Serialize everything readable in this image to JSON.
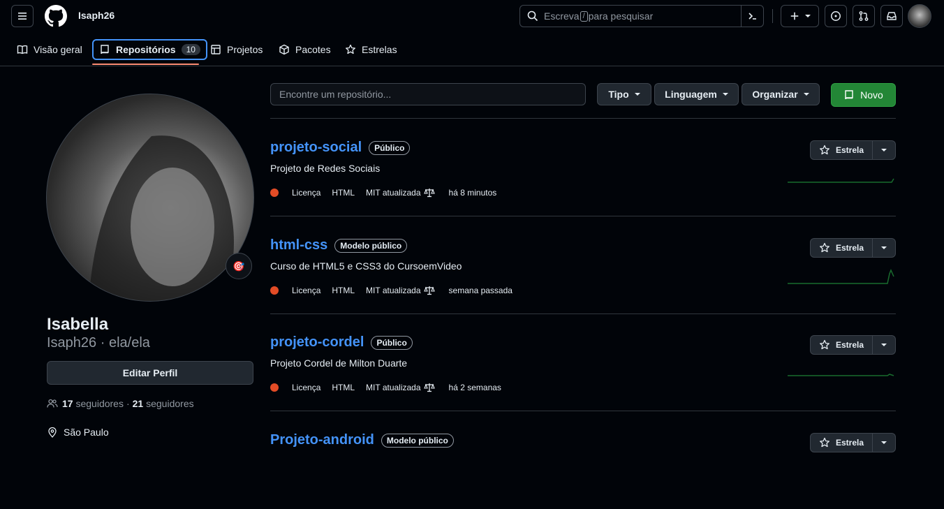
{
  "header": {
    "username": "Isaph26",
    "search_before": "Escreva",
    "search_key": "/",
    "search_after": "para pesquisar"
  },
  "tabs": [
    {
      "label": "Visão geral",
      "icon": "book-icon"
    },
    {
      "label": "Repositórios",
      "icon": "repo-icon",
      "count": "10",
      "selected": true
    },
    {
      "label": "Projetos",
      "icon": "table-icon"
    },
    {
      "label": "Pacotes",
      "icon": "package-icon"
    },
    {
      "label": "Estrelas",
      "icon": "star-icon"
    }
  ],
  "profile": {
    "fullname": "Isabella",
    "login_pronouns": "Isaph26 · ela/ela",
    "edit_label": "Editar Perfil",
    "followers_count": "17",
    "followers_label": "seguidores",
    "separator": "·",
    "following_count": "21",
    "following_label": "seguidores",
    "location": "São Paulo",
    "status_emoji": "🎯"
  },
  "toolbar": {
    "filter_placeholder": "Encontre um repositório...",
    "type_label": "Tipo",
    "language_label": "Linguagem",
    "sort_label": "Organizar",
    "new_label": "Novo"
  },
  "repos": [
    {
      "name": "projeto-social",
      "visibility": "Público",
      "description": "Projeto de Redes Sociais",
      "license": "Licença",
      "language": "HTML",
      "updated": "MIT atualizada",
      "time": "há 8 minutos",
      "star_label": "Estrela"
    },
    {
      "name": "html-css",
      "visibility": "Modelo público",
      "description": "Curso de HTML5 e CSS3 do CursoemVideo",
      "license": "Licença",
      "language": "HTML",
      "updated": "MIT atualizada",
      "time": "semana passada",
      "star_label": "Estrela"
    },
    {
      "name": "projeto-cordel",
      "visibility": "Público",
      "description": "Projeto Cordel de Milton Duarte",
      "license": "Licença",
      "language": "HTML",
      "updated": "MIT atualizada",
      "time": "há 2 semanas",
      "star_label": "Estrela"
    },
    {
      "name": "Projeto-android",
      "visibility": "Modelo público",
      "description": "",
      "license": "",
      "language": "",
      "updated": "",
      "time": "",
      "star_label": "Estrela"
    }
  ],
  "colors": {
    "accent_blue": "#4493f8",
    "new_button_green": "#238636",
    "html_language": "#e34c26",
    "tab_underline": "#fd8c73",
    "sparkline": "#196c2e"
  }
}
